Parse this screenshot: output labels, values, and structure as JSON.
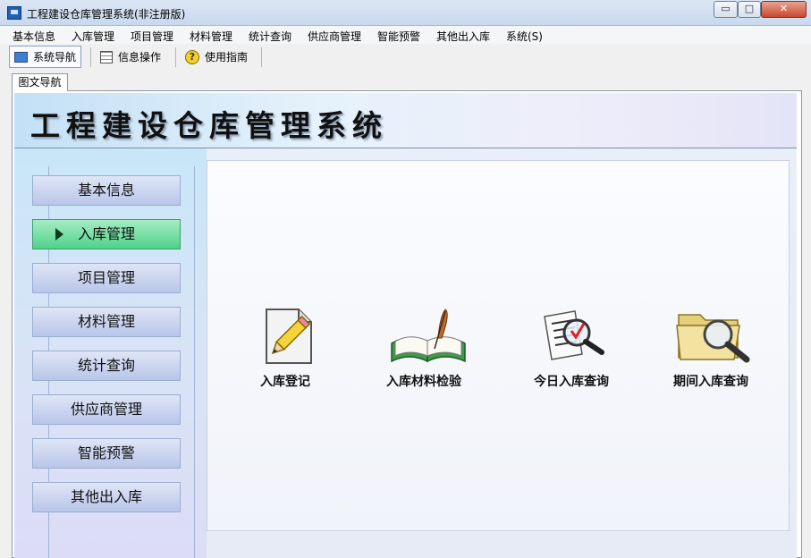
{
  "window": {
    "title": "工程建设仓库管理系统(非注册版)",
    "controls": {
      "minimize": "▭",
      "maximize": "□",
      "close": "✕"
    }
  },
  "menu": [
    "基本信息",
    "入库管理",
    "项目管理",
    "材料管理",
    "统计查询",
    "供应商管理",
    "智能预警",
    "其他出入库",
    "系统(S)"
  ],
  "toolbar": {
    "items": [
      {
        "label": "系统导航",
        "icon": "monitor-icon",
        "active": true
      },
      {
        "label": "信息操作",
        "icon": "grid-icon",
        "active": false
      },
      {
        "label": "使用指南",
        "icon": "help-icon",
        "active": false
      }
    ],
    "help_glyph": "?"
  },
  "tab": {
    "label": "图文导航"
  },
  "banner": {
    "title": "工程建设仓库管理系统"
  },
  "leftnav": {
    "items": [
      "基本信息",
      "入库管理",
      "项目管理",
      "材料管理",
      "统计查询",
      "供应商管理",
      "智能预警",
      "其他出入库"
    ],
    "active_index": 1
  },
  "functions": [
    {
      "label": "入库登记",
      "icon": "notepad-pencil-icon"
    },
    {
      "label": "入库材料检验",
      "icon": "book-quill-icon"
    },
    {
      "label": "今日入库查询",
      "icon": "document-search-icon"
    },
    {
      "label": "期间入库查询",
      "icon": "folder-search-icon"
    }
  ],
  "colors": {
    "active_nav": "#4fd28a",
    "nav_button": "#b9c6ea",
    "banner": "#c3e0f6"
  }
}
